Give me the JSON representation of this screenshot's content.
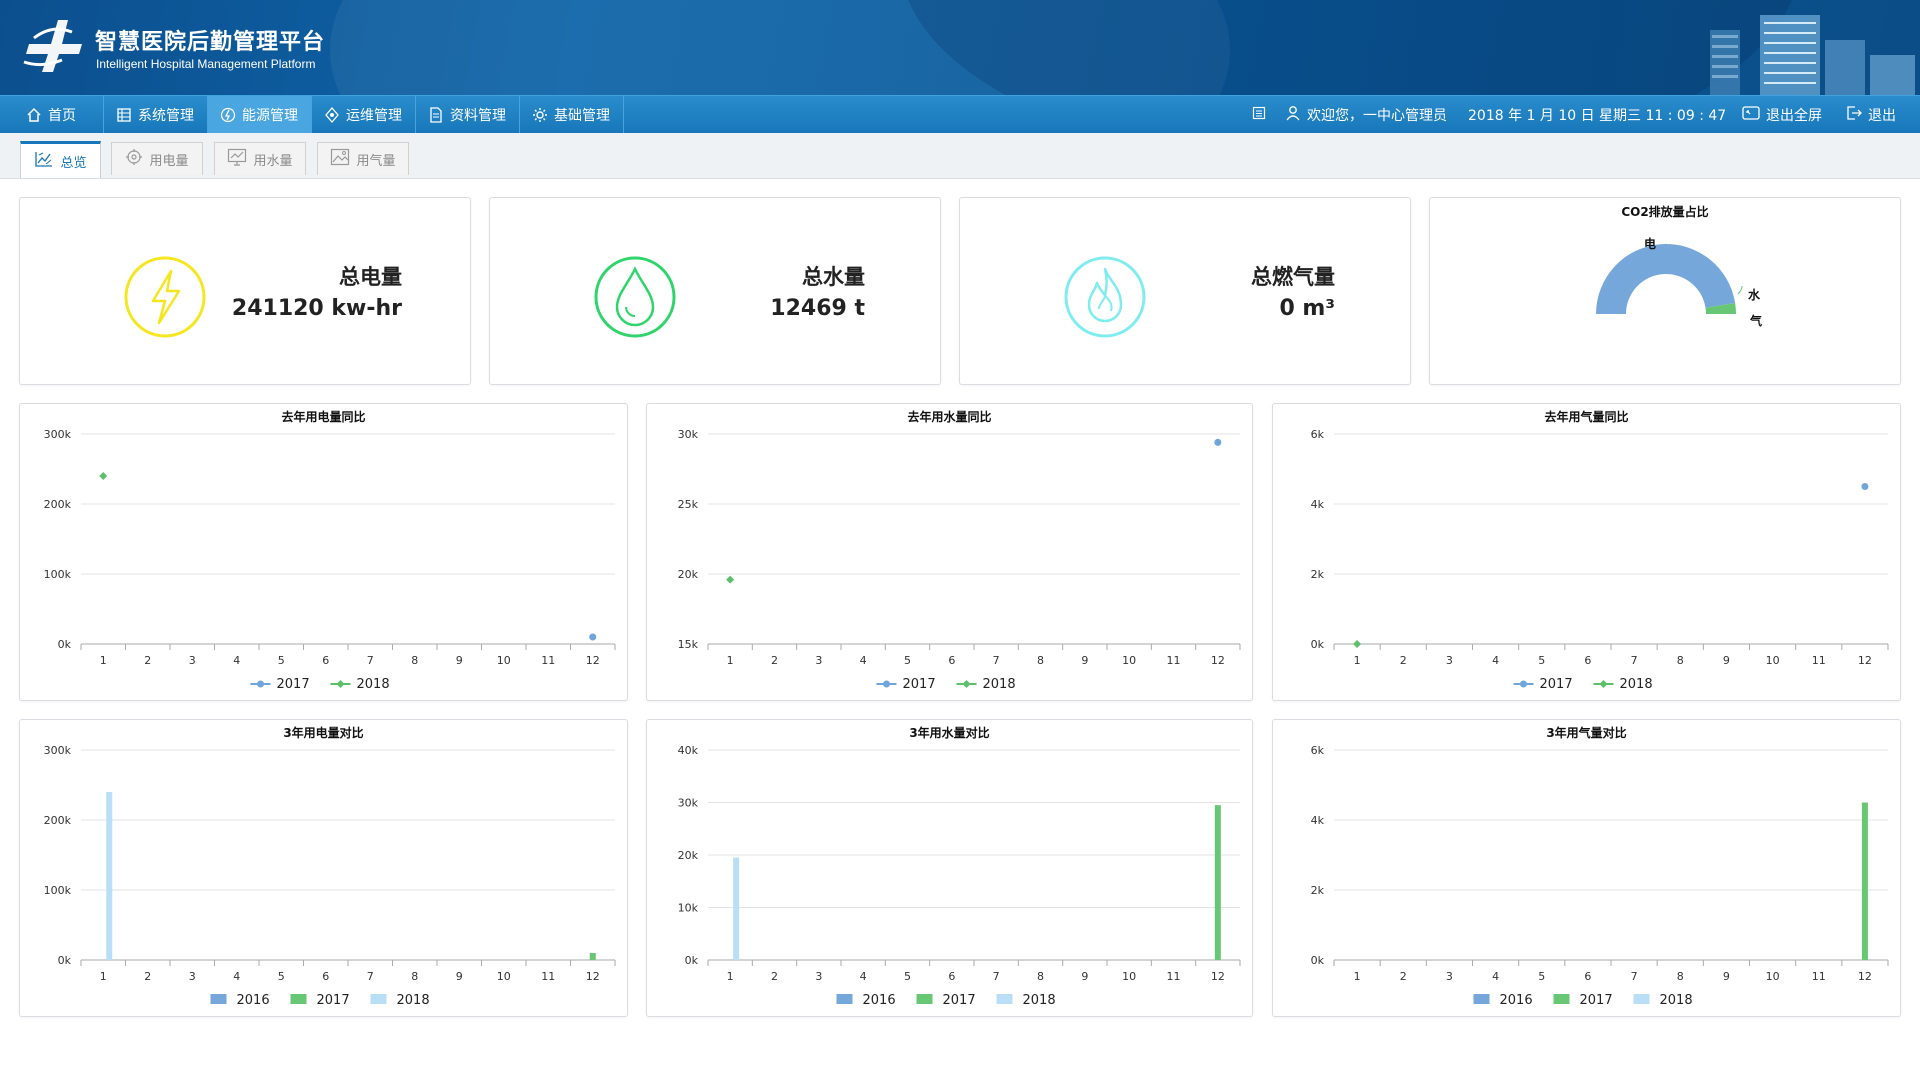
{
  "header": {
    "title_cn": "智慧医院后勤管理平台",
    "title_en": "Intelligent Hospital Management Platform"
  },
  "nav": {
    "items": [
      {
        "label": "首页",
        "icon": "home-icon"
      },
      {
        "label": "系统管理",
        "icon": "list-icon"
      },
      {
        "label": "能源管理",
        "icon": "energy-icon"
      },
      {
        "label": "运维管理",
        "icon": "maintenance-icon"
      },
      {
        "label": "资料管理",
        "icon": "document-icon"
      },
      {
        "label": "基础管理",
        "icon": "gear-icon"
      }
    ],
    "active": "能源管理",
    "welcome": "欢迎您，一中心管理员",
    "datetime": "2018 年 1 月 10 日 星期三 11 : 09 : 47",
    "exit_fullscreen": "退出全屏",
    "logout": "退出"
  },
  "subtabs": [
    {
      "label": "总览",
      "icon": "chart-icon",
      "active": true
    },
    {
      "label": "用电量",
      "icon": "target-icon",
      "active": false
    },
    {
      "label": "用水量",
      "icon": "trend-icon",
      "active": false
    },
    {
      "label": "用气量",
      "icon": "image-icon",
      "active": false
    }
  ],
  "kpis": [
    {
      "label": "总电量",
      "value": "241120 kw-hr",
      "icon": "lightning-icon",
      "color": "#f5e61f"
    },
    {
      "label": "总水量",
      "value": "12469 t",
      "icon": "water-drop-icon",
      "color": "#2fd56a"
    },
    {
      "label": "总燃气量",
      "value": "0 m³",
      "icon": "flame-icon",
      "color": "#7fecef"
    }
  ],
  "co2": {
    "title": "CO2排放量占比",
    "labels": [
      "电",
      "水",
      "气"
    ],
    "values": [
      0.95,
      0.05,
      0.0
    ],
    "colors": [
      "#76a7da",
      "#67c775",
      "#b5d9ef"
    ]
  },
  "colors": {
    "s2016": "#76a7da",
    "s2017": "#67c775",
    "s2018": "#b8dff5",
    "line2017": "#6fa5d8",
    "line2018": "#5cbf6a"
  },
  "chart_data": [
    {
      "type": "line",
      "title": "去年用电量同比",
      "categories": [
        "1",
        "2",
        "3",
        "4",
        "5",
        "6",
        "7",
        "8",
        "9",
        "10",
        "11",
        "12"
      ],
      "ylim": [
        0,
        300000
      ],
      "yticks": [
        "300k",
        "200k",
        "100k",
        "0k"
      ],
      "series": [
        {
          "name": "2017",
          "values": [
            null,
            null,
            null,
            null,
            null,
            null,
            null,
            null,
            null,
            null,
            null,
            10000
          ]
        },
        {
          "name": "2018",
          "values": [
            240000,
            null,
            null,
            null,
            null,
            null,
            null,
            null,
            null,
            null,
            null,
            null
          ]
        }
      ]
    },
    {
      "type": "line",
      "title": "去年用水量同比",
      "categories": [
        "1",
        "2",
        "3",
        "4",
        "5",
        "6",
        "7",
        "8",
        "9",
        "10",
        "11",
        "12"
      ],
      "ylim": [
        15000,
        30000
      ],
      "yticks": [
        "30k",
        "25k",
        "20k",
        "15k"
      ],
      "series": [
        {
          "name": "2017",
          "values": [
            null,
            null,
            null,
            null,
            null,
            null,
            null,
            null,
            null,
            null,
            null,
            29400
          ]
        },
        {
          "name": "2018",
          "values": [
            19600,
            null,
            null,
            null,
            null,
            null,
            null,
            null,
            null,
            null,
            null,
            null
          ]
        }
      ]
    },
    {
      "type": "line",
      "title": "去年用气量同比",
      "categories": [
        "1",
        "2",
        "3",
        "4",
        "5",
        "6",
        "7",
        "8",
        "9",
        "10",
        "11",
        "12"
      ],
      "ylim": [
        0,
        6000
      ],
      "yticks": [
        "6k",
        "4k",
        "2k",
        "0k"
      ],
      "series": [
        {
          "name": "2017",
          "values": [
            null,
            null,
            null,
            null,
            null,
            null,
            null,
            null,
            null,
            null,
            null,
            4500
          ]
        },
        {
          "name": "2018",
          "values": [
            0,
            null,
            null,
            null,
            null,
            null,
            null,
            null,
            null,
            null,
            null,
            null
          ]
        }
      ]
    },
    {
      "type": "bar",
      "title": "3年用电量对比",
      "categories": [
        "1",
        "2",
        "3",
        "4",
        "5",
        "6",
        "7",
        "8",
        "9",
        "10",
        "11",
        "12"
      ],
      "ylim": [
        0,
        300000
      ],
      "yticks": [
        "300k",
        "200k",
        "100k",
        "0k"
      ],
      "series": [
        {
          "name": "2016",
          "values": [
            0,
            0,
            0,
            0,
            0,
            0,
            0,
            0,
            0,
            0,
            0,
            0
          ]
        },
        {
          "name": "2017",
          "values": [
            0,
            0,
            0,
            0,
            0,
            0,
            0,
            0,
            0,
            0,
            0,
            10000
          ]
        },
        {
          "name": "2018",
          "values": [
            240000,
            0,
            0,
            0,
            0,
            0,
            0,
            0,
            0,
            0,
            0,
            0
          ]
        }
      ]
    },
    {
      "type": "bar",
      "title": "3年用水量对比",
      "categories": [
        "1",
        "2",
        "3",
        "4",
        "5",
        "6",
        "7",
        "8",
        "9",
        "10",
        "11",
        "12"
      ],
      "ylim": [
        0,
        40000
      ],
      "yticks": [
        "40k",
        "30k",
        "20k",
        "10k",
        "0k"
      ],
      "series": [
        {
          "name": "2016",
          "values": [
            0,
            0,
            0,
            0,
            0,
            0,
            0,
            0,
            0,
            0,
            0,
            0
          ]
        },
        {
          "name": "2017",
          "values": [
            0,
            0,
            0,
            0,
            0,
            0,
            0,
            0,
            0,
            0,
            0,
            29500
          ]
        },
        {
          "name": "2018",
          "values": [
            19500,
            0,
            0,
            0,
            0,
            0,
            0,
            0,
            0,
            0,
            0,
            0
          ]
        }
      ]
    },
    {
      "type": "bar",
      "title": "3年用气量对比",
      "categories": [
        "1",
        "2",
        "3",
        "4",
        "5",
        "6",
        "7",
        "8",
        "9",
        "10",
        "11",
        "12"
      ],
      "ylim": [
        0,
        6000
      ],
      "yticks": [
        "6k",
        "4k",
        "2k",
        "0k"
      ],
      "series": [
        {
          "name": "2016",
          "values": [
            0,
            0,
            0,
            0,
            0,
            0,
            0,
            0,
            0,
            0,
            0,
            0
          ]
        },
        {
          "name": "2017",
          "values": [
            0,
            0,
            0,
            0,
            0,
            0,
            0,
            0,
            0,
            0,
            0,
            4500
          ]
        },
        {
          "name": "2018",
          "values": [
            0,
            0,
            0,
            0,
            0,
            0,
            0,
            0,
            0,
            0,
            0,
            0
          ]
        }
      ]
    }
  ]
}
